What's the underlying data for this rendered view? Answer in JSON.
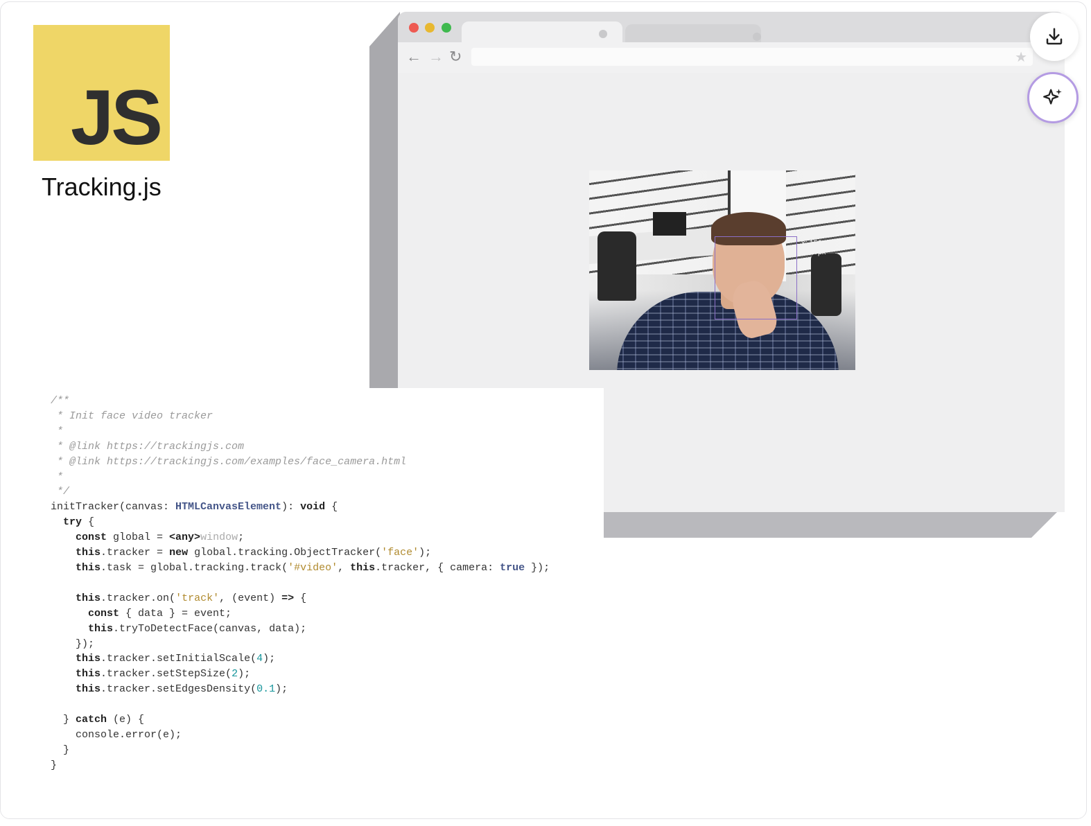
{
  "logo": {
    "text": "JS"
  },
  "title": "Tracking.js",
  "browser": {
    "nav": {
      "back": "←",
      "forward": "→",
      "reload": "↻"
    },
    "star": "★"
  },
  "webcam": {
    "overlay_x": "x: 150px",
    "overlay_y": "y: 80px",
    "box_color": "#8b6fc7"
  },
  "code": {
    "lines": [
      [
        {
          "c": "c",
          "t": "/**"
        }
      ],
      [
        {
          "c": "c",
          "t": " * Init face video tracker"
        }
      ],
      [
        {
          "c": "c",
          "t": " *"
        }
      ],
      [
        {
          "c": "c",
          "t": " * @link https://trackingjs.com"
        }
      ],
      [
        {
          "c": "c",
          "t": " * @link https://trackingjs.com/examples/face_camera.html"
        }
      ],
      [
        {
          "c": "c",
          "t": " *"
        }
      ],
      [
        {
          "c": "c",
          "t": " */"
        }
      ],
      [
        {
          "c": "",
          "t": "initTracker(canvas: "
        },
        {
          "c": "t",
          "t": "HTMLCanvasElement"
        },
        {
          "c": "",
          "t": "): "
        },
        {
          "c": "k",
          "t": "void"
        },
        {
          "c": "",
          "t": " {"
        }
      ],
      [
        {
          "c": "",
          "t": "  "
        },
        {
          "c": "k",
          "t": "try"
        },
        {
          "c": "",
          "t": " {"
        }
      ],
      [
        {
          "c": "",
          "t": "    "
        },
        {
          "c": "k",
          "t": "const"
        },
        {
          "c": "",
          "t": " global = "
        },
        {
          "c": "k",
          "t": "<any>"
        },
        {
          "c": "g",
          "t": "window"
        },
        {
          "c": "",
          "t": ";"
        }
      ],
      [
        {
          "c": "",
          "t": "    "
        },
        {
          "c": "k",
          "t": "this"
        },
        {
          "c": "",
          "t": ".tracker = "
        },
        {
          "c": "k",
          "t": "new"
        },
        {
          "c": "",
          "t": " global.tracking.ObjectTracker("
        },
        {
          "c": "s",
          "t": "'face'"
        },
        {
          "c": "",
          "t": ");"
        }
      ],
      [
        {
          "c": "",
          "t": "    "
        },
        {
          "c": "k",
          "t": "this"
        },
        {
          "c": "",
          "t": ".task = global.tracking.track("
        },
        {
          "c": "s",
          "t": "'#video'"
        },
        {
          "c": "",
          "t": ", "
        },
        {
          "c": "k",
          "t": "this"
        },
        {
          "c": "",
          "t": ".tracker, { camera: "
        },
        {
          "c": "t",
          "t": "true"
        },
        {
          "c": "",
          "t": " });"
        }
      ],
      [
        {
          "c": "",
          "t": ""
        }
      ],
      [
        {
          "c": "",
          "t": "    "
        },
        {
          "c": "k",
          "t": "this"
        },
        {
          "c": "",
          "t": ".tracker.on("
        },
        {
          "c": "s",
          "t": "'track'"
        },
        {
          "c": "",
          "t": ", (event) "
        },
        {
          "c": "k",
          "t": "=>"
        },
        {
          "c": "",
          "t": " {"
        }
      ],
      [
        {
          "c": "",
          "t": "      "
        },
        {
          "c": "k",
          "t": "const"
        },
        {
          "c": "",
          "t": " { data } = event;"
        }
      ],
      [
        {
          "c": "",
          "t": "      "
        },
        {
          "c": "k",
          "t": "this"
        },
        {
          "c": "",
          "t": ".tryToDetectFace(canvas, data);"
        }
      ],
      [
        {
          "c": "",
          "t": "    });"
        }
      ],
      [
        {
          "c": "",
          "t": "    "
        },
        {
          "c": "k",
          "t": "this"
        },
        {
          "c": "",
          "t": ".tracker.setInitialScale("
        },
        {
          "c": "n",
          "t": "4"
        },
        {
          "c": "",
          "t": ");"
        }
      ],
      [
        {
          "c": "",
          "t": "    "
        },
        {
          "c": "k",
          "t": "this"
        },
        {
          "c": "",
          "t": ".tracker.setStepSize("
        },
        {
          "c": "n",
          "t": "2"
        },
        {
          "c": "",
          "t": ");"
        }
      ],
      [
        {
          "c": "",
          "t": "    "
        },
        {
          "c": "k",
          "t": "this"
        },
        {
          "c": "",
          "t": ".tracker.setEdgesDensity("
        },
        {
          "c": "n",
          "t": "0.1"
        },
        {
          "c": "",
          "t": ");"
        }
      ],
      [
        {
          "c": "",
          "t": ""
        }
      ],
      [
        {
          "c": "",
          "t": "  } "
        },
        {
          "c": "k",
          "t": "catch"
        },
        {
          "c": "",
          "t": " (e) {"
        }
      ],
      [
        {
          "c": "",
          "t": "    console.error(e);"
        }
      ],
      [
        {
          "c": "",
          "t": "  }"
        }
      ],
      [
        {
          "c": "",
          "t": "}"
        }
      ]
    ]
  },
  "actions": {
    "download_icon": "download-icon",
    "ai_icon": "sparkle-icon"
  },
  "colors": {
    "js_yellow": "#efd667",
    "dot_red": "#ee5a52",
    "dot_yellow": "#e8b830",
    "dot_green": "#3fb94e",
    "ai_ring": "#b49be3"
  }
}
